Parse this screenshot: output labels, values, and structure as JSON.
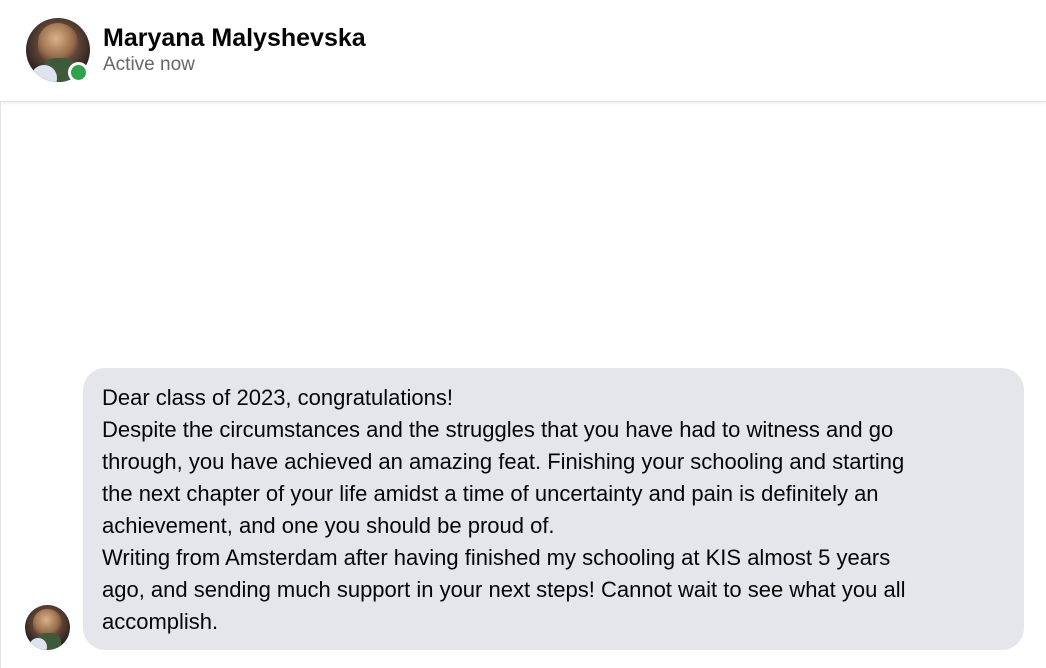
{
  "header": {
    "contact_name": "Maryana Malyshevska",
    "status": "Active now",
    "online_color": "#31a24c"
  },
  "message": {
    "lines": [
      "Dear class of 2023, congratulations!",
      "Despite the circumstances and the struggles that you have had to witness and go",
      "through, you have achieved an amazing feat. Finishing your schooling and starting",
      "the next chapter of your life amidst a time of uncertainty and pain is definitely an",
      "achievement, and one you should be proud of.",
      "Writing from Amsterdam after having finished my schooling at KIS almost 5 years",
      "ago, and sending much support in your next steps! Cannot wait to see what you all",
      "accomplish."
    ],
    "bubble_color": "#e4e6eb"
  }
}
